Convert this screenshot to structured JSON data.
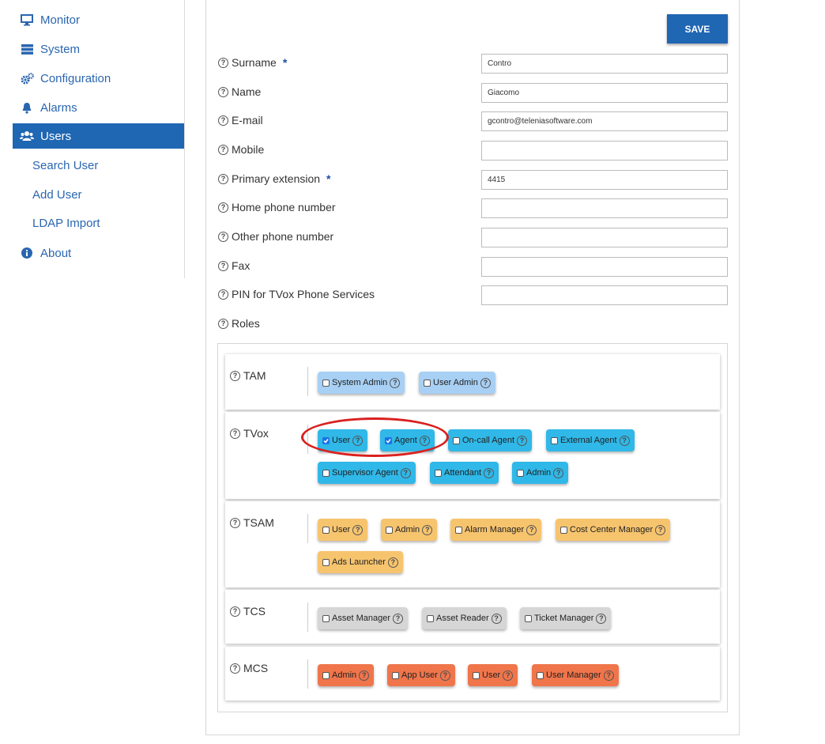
{
  "sidebar": {
    "items": [
      {
        "label": "Monitor",
        "icon": "monitor-icon"
      },
      {
        "label": "System",
        "icon": "server-icon"
      },
      {
        "label": "Configuration",
        "icon": "gears-icon"
      },
      {
        "label": "Alarms",
        "icon": "bell-icon"
      },
      {
        "label": "Users",
        "icon": "users-icon",
        "active": true
      }
    ],
    "sub_items": [
      "Search User",
      "Add User",
      "LDAP Import"
    ],
    "about": {
      "label": "About",
      "icon": "info-icon"
    }
  },
  "toolbar": {
    "save_label": "SAVE"
  },
  "form": {
    "fields": [
      {
        "label": "Surname",
        "required": true,
        "value": "Contro"
      },
      {
        "label": "Name",
        "required": false,
        "value": "Giacomo"
      },
      {
        "label": "E-mail",
        "required": false,
        "value": "gcontro@teleniasoftware.com"
      },
      {
        "label": "Mobile",
        "required": false,
        "value": ""
      },
      {
        "label": "Primary extension",
        "required": true,
        "value": "4415"
      },
      {
        "label": "Home phone number",
        "required": false,
        "value": ""
      },
      {
        "label": "Other phone number",
        "required": false,
        "value": ""
      },
      {
        "label": "Fax",
        "required": false,
        "value": ""
      },
      {
        "label": "PIN for TVox Phone Services",
        "required": false,
        "value": ""
      }
    ],
    "required_mark": "*",
    "help_glyph": "?",
    "roles_label": "Roles"
  },
  "roles": [
    {
      "group": "TAM",
      "color": "#a8d0f4",
      "roles": [
        {
          "label": "System Admin",
          "checked": false
        },
        {
          "label": "User Admin",
          "checked": false
        }
      ]
    },
    {
      "group": "TVox",
      "color": "#30b8e8",
      "roles": [
        {
          "label": "User",
          "checked": true
        },
        {
          "label": "Agent",
          "checked": true
        },
        {
          "label": "On-call Agent",
          "checked": false
        },
        {
          "label": "External Agent",
          "checked": false
        },
        {
          "label": "Supervisor Agent",
          "checked": false
        },
        {
          "label": "Attendant",
          "checked": false
        },
        {
          "label": "Admin",
          "checked": false
        }
      ]
    },
    {
      "group": "TSAM",
      "color": "#f7c46e",
      "roles": [
        {
          "label": "User",
          "checked": false
        },
        {
          "label": "Admin",
          "checked": false
        },
        {
          "label": "Alarm Manager",
          "checked": false
        },
        {
          "label": "Cost Center Manager",
          "checked": false
        },
        {
          "label": "Ads Launcher",
          "checked": false
        }
      ]
    },
    {
      "group": "TCS",
      "color": "#d6d6d6",
      "roles": [
        {
          "label": "Asset Manager",
          "checked": false
        },
        {
          "label": "Asset Reader",
          "checked": false
        },
        {
          "label": "Ticket Manager",
          "checked": false
        }
      ]
    },
    {
      "group": "MCS",
      "color": "#f0754b",
      "roles": [
        {
          "label": "Admin",
          "checked": false
        },
        {
          "label": "App User",
          "checked": false
        },
        {
          "label": "User",
          "checked": false
        },
        {
          "label": "User Manager",
          "checked": false
        }
      ]
    }
  ],
  "colors": {
    "accent": "#1f66b3",
    "annotation": "#d9201f"
  }
}
